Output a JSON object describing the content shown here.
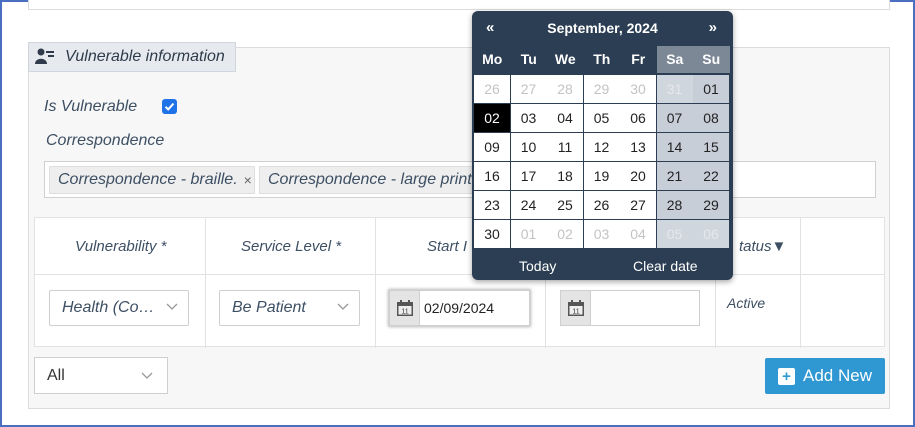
{
  "section": {
    "title": "Vulnerable information",
    "icon": "user-id-icon"
  },
  "form": {
    "is_vulnerable_label": "Is Vulnerable",
    "is_vulnerable_checked": true,
    "correspondence_label": "Correspondence",
    "correspondence_tags": [
      {
        "label": "Correspondence - braille.",
        "remove": "×"
      },
      {
        "label": "Correspondence - large print",
        "remove": ""
      }
    ]
  },
  "grid": {
    "headers": {
      "vulnerability": "Vulnerability *",
      "service_level": "Service Level *",
      "start": "Start I",
      "status": "tatus▼"
    },
    "row": {
      "vulnerability": "Health (Co…",
      "service_level": "Be Patient",
      "start_date": "02/09/2024",
      "end_date": "",
      "status": "Active",
      "calendar_icon_day": "11"
    }
  },
  "footer": {
    "filter_value": "All",
    "add_new_label": "Add New"
  },
  "datepicker": {
    "prev": "«",
    "next": "»",
    "month_title": "September, 2024",
    "weekdays": [
      "Mo",
      "Tu",
      "We",
      "Th",
      "Fr",
      "Sa",
      "Su"
    ],
    "weeks": [
      [
        "26",
        "27",
        "28",
        "29",
        "30",
        "31",
        "01"
      ],
      [
        "02",
        "03",
        "04",
        "05",
        "06",
        "07",
        "08"
      ],
      [
        "09",
        "10",
        "11",
        "12",
        "13",
        "14",
        "15"
      ],
      [
        "16",
        "17",
        "18",
        "19",
        "20",
        "21",
        "22"
      ],
      [
        "23",
        "24",
        "25",
        "26",
        "27",
        "28",
        "29"
      ],
      [
        "30",
        "01",
        "02",
        "03",
        "04",
        "05",
        "06"
      ]
    ],
    "selected": "02",
    "today_label": "Today",
    "clear_label": "Clear date"
  },
  "colors": {
    "accent": "#2f97d1",
    "checkbox": "#1e73e8",
    "picker_bg": "#2c3e54"
  }
}
